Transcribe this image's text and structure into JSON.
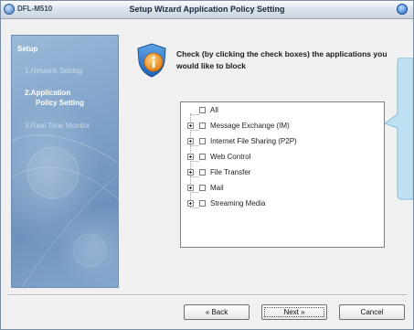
{
  "titlebar": {
    "app_name": "DFL-M510",
    "window_title": "Setup Wizard  Application Policy Setting"
  },
  "sidebar": {
    "heading": "Setup",
    "steps": [
      {
        "label": "1.Network Setting",
        "state": "inactive"
      },
      {
        "label_line1": "2.Application",
        "label_line2": "Policy Setting",
        "state": "active"
      },
      {
        "label": "3.Real Time Monitor",
        "state": "inactive"
      }
    ]
  },
  "header": {
    "instruction": "Check (by clicking the check boxes) the applications you would like to block",
    "icon": "info-shield-icon"
  },
  "tree": {
    "root": {
      "label": "All",
      "checked": false
    },
    "items": [
      {
        "label": "Message Exchange (IM)",
        "checked": false,
        "expandable": true
      },
      {
        "label": "Internet File Sharing (P2P)",
        "checked": false,
        "expandable": true
      },
      {
        "label": "Web Control",
        "checked": false,
        "expandable": true
      },
      {
        "label": "File Transfer",
        "checked": false,
        "expandable": true
      },
      {
        "label": "Mail",
        "checked": false,
        "expandable": true
      },
      {
        "label": "Streaming Media",
        "checked": false,
        "expandable": true
      }
    ]
  },
  "buttons": {
    "back": "« Back",
    "next": "Next »",
    "cancel": "Cancel"
  },
  "colors": {
    "sidebar": "#7fa2c9",
    "callout": "#b9dcf0",
    "callout_border": "#7fb4d6"
  }
}
